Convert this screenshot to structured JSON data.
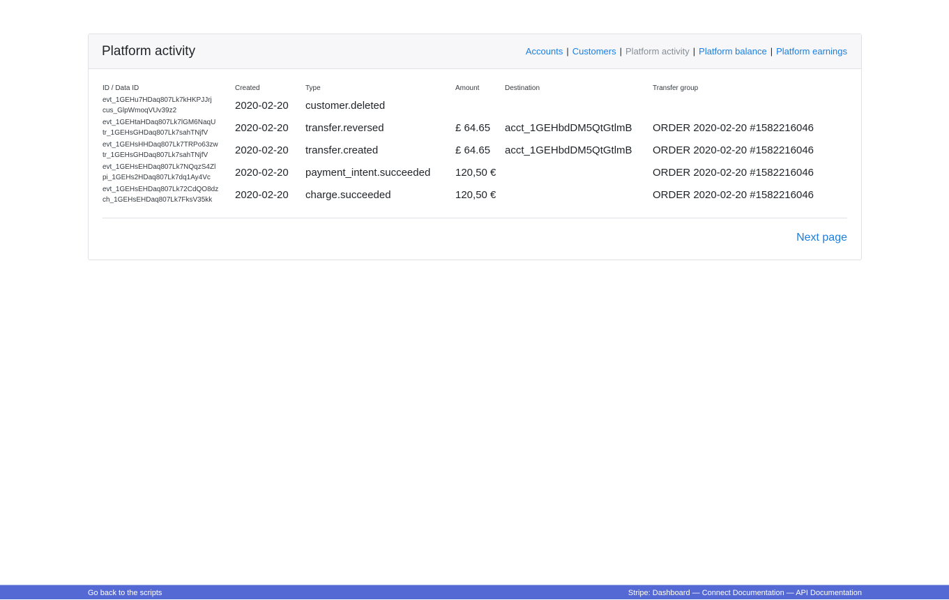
{
  "card": {
    "title": "Platform activity"
  },
  "nav": {
    "accounts": "Accounts",
    "customers": "Customers",
    "platform_activity": "Platform activity",
    "platform_balance": "Platform balance",
    "platform_earnings": "Platform earnings",
    "separator": "|"
  },
  "table": {
    "headers": {
      "id": "ID / Data ID",
      "created": "Created",
      "type": "Type",
      "amount": "Amount",
      "destination": "Destination",
      "transfer_group": "Transfer group"
    },
    "rows": [
      {
        "id": "evt_1GEHu7HDaq807Lk7kHKPJJrj",
        "data_id": "cus_GlpWmoqVUv39z2",
        "created": "2020-02-20",
        "type": "customer.deleted",
        "amount": "",
        "destination": "",
        "transfer_group": ""
      },
      {
        "id": "evt_1GEHtaHDaq807Lk7lGM6NaqU",
        "data_id": "tr_1GEHsGHDaq807Lk7sahTNjfV",
        "created": "2020-02-20",
        "type": "transfer.reversed",
        "amount": "£ 64.65",
        "destination": "acct_1GEHbdDM5QtGtlmB",
        "transfer_group": "ORDER 2020-02-20 #1582216046"
      },
      {
        "id": "evt_1GEHsHHDaq807Lk7TRPo63zw",
        "data_id": "tr_1GEHsGHDaq807Lk7sahTNjfV",
        "created": "2020-02-20",
        "type": "transfer.created",
        "amount": "£ 64.65",
        "destination": "acct_1GEHbdDM5QtGtlmB",
        "transfer_group": "ORDER 2020-02-20 #1582216046"
      },
      {
        "id": "evt_1GEHsEHDaq807Lk7NQqzS4Zl",
        "data_id": "pi_1GEHs2HDaq807Lk7dq1Ay4Vc",
        "created": "2020-02-20",
        "type": "payment_intent.succeeded",
        "amount": "120,50 €",
        "destination": "",
        "transfer_group": "ORDER 2020-02-20 #1582216046"
      },
      {
        "id": "evt_1GEHsEHDaq807Lk72CdQO8dz",
        "data_id": "ch_1GEHsEHDaq807Lk7FksV35kk",
        "created": "2020-02-20",
        "type": "charge.succeeded",
        "amount": "120,50 €",
        "destination": "",
        "transfer_group": "ORDER 2020-02-20 #1582216046"
      }
    ]
  },
  "pager": {
    "next": "Next page"
  },
  "footer": {
    "back": "Go back to the scripts",
    "links": "Stripe: Dashboard — Connect Documentation — API Documentation"
  }
}
